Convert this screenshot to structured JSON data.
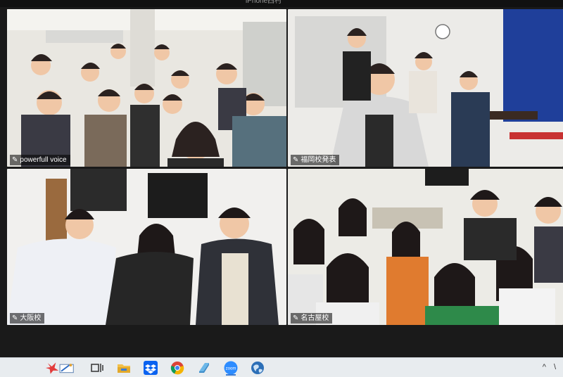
{
  "window": {
    "camera_label": "iPhone西村"
  },
  "tiles": [
    {
      "name": "powerfull voice",
      "active": true
    },
    {
      "name": "福岡校発表",
      "active": false
    },
    {
      "name": "大阪校",
      "active": false
    },
    {
      "name": "名古屋校",
      "active": false
    }
  ],
  "taskbar": {
    "items": [
      {
        "icon": "paint-brush-app-icon"
      },
      {
        "icon": "task-view-icon"
      },
      {
        "icon": "file-explorer-icon"
      },
      {
        "icon": "dropbox-icon"
      },
      {
        "icon": "chrome-icon"
      },
      {
        "icon": "document-app-icon"
      },
      {
        "icon": "zoom-icon",
        "label": "zoom"
      },
      {
        "icon": "globe-app-icon"
      }
    ],
    "tray_chevron": "^",
    "tray_extra": "\\"
  },
  "colors": {
    "active_border": "#b7e04a",
    "background": "#1a1a1a",
    "taskbar": "#e8ecef"
  }
}
